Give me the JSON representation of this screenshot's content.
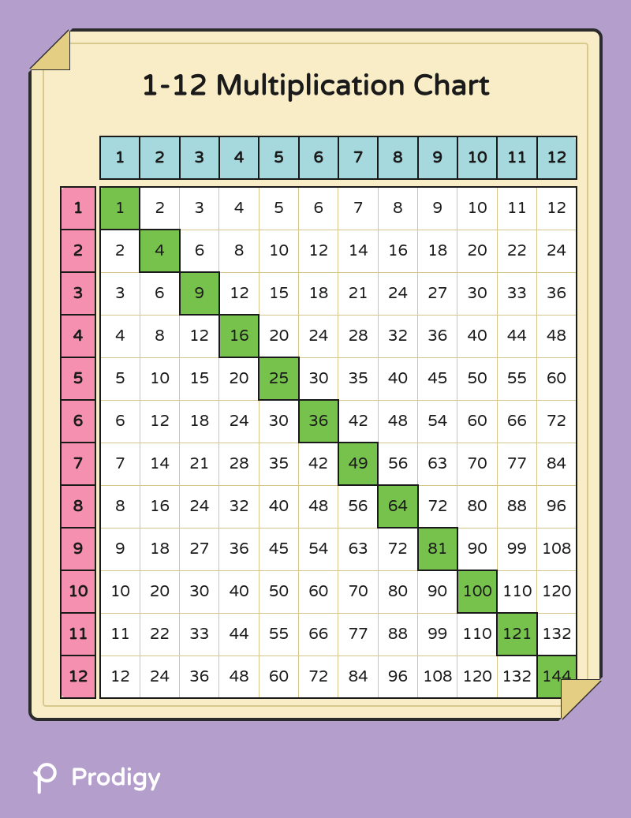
{
  "title": "1-12 Multiplication Chart",
  "brand": {
    "name": "Prodigy"
  },
  "colors": {
    "background": "#B49ECC",
    "paper": "#F8EDC6",
    "col_header": "#A6D9DE",
    "row_header": "#F690B1",
    "diagonal": "#77C24C",
    "gridline": "#D6C68A",
    "outline": "#1A1A1A"
  },
  "chart_data": {
    "type": "table",
    "title": "1-12 Multiplication Chart",
    "columns": [
      1,
      2,
      3,
      4,
      5,
      6,
      7,
      8,
      9,
      10,
      11,
      12
    ],
    "rows": [
      1,
      2,
      3,
      4,
      5,
      6,
      7,
      8,
      9,
      10,
      11,
      12
    ],
    "values": [
      [
        1,
        2,
        3,
        4,
        5,
        6,
        7,
        8,
        9,
        10,
        11,
        12
      ],
      [
        2,
        4,
        6,
        8,
        10,
        12,
        14,
        16,
        18,
        20,
        22,
        24
      ],
      [
        3,
        6,
        9,
        12,
        15,
        18,
        21,
        24,
        27,
        30,
        33,
        36
      ],
      [
        4,
        8,
        12,
        16,
        20,
        24,
        28,
        32,
        36,
        40,
        44,
        48
      ],
      [
        5,
        10,
        15,
        20,
        25,
        30,
        35,
        40,
        45,
        50,
        55,
        60
      ],
      [
        6,
        12,
        18,
        24,
        30,
        36,
        42,
        48,
        54,
        60,
        66,
        72
      ],
      [
        7,
        14,
        21,
        28,
        35,
        42,
        49,
        56,
        63,
        70,
        77,
        84
      ],
      [
        8,
        16,
        24,
        32,
        40,
        48,
        56,
        64,
        72,
        80,
        88,
        96
      ],
      [
        9,
        18,
        27,
        36,
        45,
        54,
        63,
        72,
        81,
        90,
        99,
        108
      ],
      [
        10,
        20,
        30,
        40,
        50,
        60,
        70,
        80,
        90,
        100,
        110,
        120
      ],
      [
        11,
        22,
        33,
        44,
        55,
        66,
        77,
        88,
        99,
        110,
        121,
        132
      ],
      [
        12,
        24,
        36,
        48,
        60,
        72,
        84,
        96,
        108,
        120,
        132,
        144
      ]
    ],
    "highlight_diagonal": true
  }
}
